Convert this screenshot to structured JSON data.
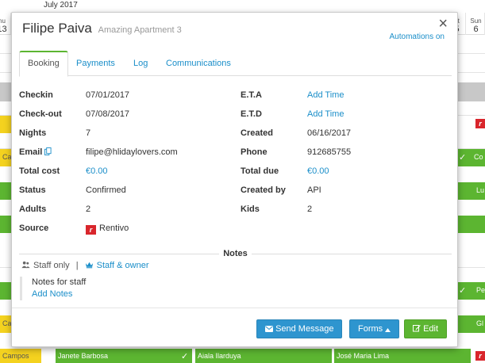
{
  "calendar": {
    "month": "July 2017",
    "days": [
      {
        "name": "hu",
        "num": "13"
      },
      {
        "name": "at",
        "num": "5"
      },
      {
        "name": "Sun",
        "num": "6"
      }
    ],
    "left_labels": [
      "Cam",
      "Cam",
      "Campos"
    ],
    "right_labels": [
      "Co",
      "Lu",
      "Pe",
      "Gl"
    ],
    "bottom_bars": [
      "Janete Barbosa",
      "Aiala Ilarduya",
      "José Maria Lima"
    ]
  },
  "modal": {
    "guest_name": "Filipe Paiva",
    "property": "Amazing Apartment 3",
    "close": "×",
    "automations": "Automations on",
    "tabs": [
      "Booking",
      "Payments",
      "Log",
      "Communications"
    ],
    "details": {
      "checkin_label": "Checkin",
      "checkin": "07/01/2017",
      "eta_label": "E.T.A",
      "eta": "Add Time",
      "checkout_label": "Check-out",
      "checkout": "07/08/2017",
      "etd_label": "E.T.D",
      "etd": "Add Time",
      "nights_label": "Nights",
      "nights": "7",
      "created_label": "Created",
      "created": "06/16/2017",
      "email_label": "Email",
      "email": "filipe@hlidaylovers.com",
      "phone_label": "Phone",
      "phone": "912685755",
      "total_cost_label": "Total cost",
      "total_cost": "€0.00",
      "total_due_label": "Total due",
      "total_due": "€0.00",
      "status_label": "Status",
      "status": "Confirmed",
      "created_by_label": "Created by",
      "created_by": "API",
      "adults_label": "Adults",
      "adults": "2",
      "kids_label": "Kids",
      "kids": "2",
      "source_label": "Source",
      "source": "Rentivo"
    },
    "notes": {
      "title": "Notes",
      "staff_only": "Staff only",
      "separator": "|",
      "staff_owner": "Staff & owner",
      "note_text": "Notes for staff",
      "add_notes": "Add Notes"
    },
    "buttons": {
      "send_message": "Send Message",
      "forms": "Forms",
      "edit": "Edit"
    }
  },
  "colors": {
    "accent": "#1a8ec9",
    "green": "#5cb531",
    "yellow": "#f4d21f",
    "rentivo_red": "#d9262c"
  }
}
